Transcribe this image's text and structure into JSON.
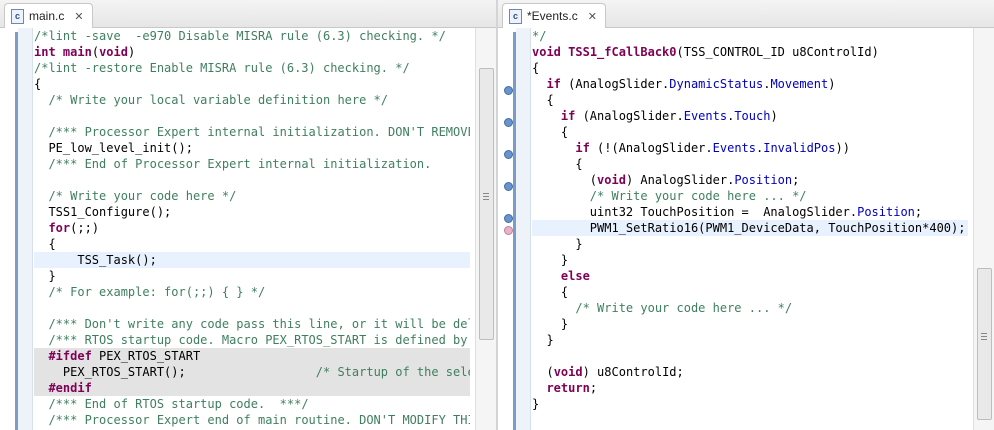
{
  "left": {
    "tab": {
      "label": "main.c",
      "icon": "c-file-icon"
    },
    "lines": [
      [
        {
          "t": "/*lint -save  -e970 Disable MISRA rule (6.3) checking. */",
          "c": "c"
        }
      ],
      [
        {
          "t": "int",
          "c": "k"
        },
        {
          "t": " "
        },
        {
          "t": "main",
          "c": "k"
        },
        {
          "t": "("
        },
        {
          "t": "void",
          "c": "k"
        },
        {
          "t": ")"
        }
      ],
      [
        {
          "t": "/*lint -restore Enable MISRA rule (6.3) checking. */",
          "c": "c"
        }
      ],
      [
        {
          "t": "{"
        }
      ],
      [
        {
          "t": "  "
        },
        {
          "t": "/* Write your local variable definition here */",
          "c": "c"
        }
      ],
      [],
      [
        {
          "t": "  "
        },
        {
          "t": "/*** Processor Expert internal initialization. DON'T REMOVE THIS CODE!!! ***/",
          "c": "c"
        }
      ],
      [
        {
          "t": "  PE_low_level_init();"
        }
      ],
      [
        {
          "t": "  "
        },
        {
          "t": "/*** End of Processor Expert internal initialization.                    ***/",
          "c": "c"
        }
      ],
      [],
      [
        {
          "t": "  "
        },
        {
          "t": "/* Write your code here */",
          "c": "c"
        }
      ],
      [
        {
          "t": "  TSS1_Configure();"
        }
      ],
      [
        {
          "t": "  "
        },
        {
          "t": "for",
          "c": "k"
        },
        {
          "t": "(;;)"
        }
      ],
      [
        {
          "t": "  {"
        }
      ],
      [
        {
          "t": "      TSS_Task();"
        }
      ],
      [
        {
          "t": "  }"
        }
      ],
      [
        {
          "t": "  "
        },
        {
          "t": "/* For example: for(;;) { } */",
          "c": "c"
        }
      ],
      [],
      [
        {
          "t": "  "
        },
        {
          "t": "/*** Don't write any code pass this line, or it will be deleted during code generation. ***/",
          "c": "c"
        }
      ],
      [
        {
          "t": "  "
        },
        {
          "t": "/*** RTOS startup code. Macro PEX_RTOS_START is defined by the RTOS component. DON'T MODIFY THIS CODE!!! ***/",
          "c": "c"
        }
      ],
      [
        {
          "t": "  "
        },
        {
          "t": "#ifdef",
          "c": "k"
        },
        {
          "t": " PEX_RTOS_START"
        }
      ],
      [
        {
          "t": "    PEX_RTOS_START();                  "
        },
        {
          "t": "/* Startup of the selected RTOS. Macro is defined by the RTOS component. */",
          "c": "c"
        }
      ],
      [
        {
          "t": "  "
        },
        {
          "t": "#endif",
          "c": "k"
        }
      ],
      [
        {
          "t": "  "
        },
        {
          "t": "/*** End of RTOS startup code.  ***/",
          "c": "c"
        }
      ],
      [
        {
          "t": "  "
        },
        {
          "t": "/*** Processor Expert end of main routine. DON'T MODIFY THIS CODE!!! ***/",
          "c": "c"
        }
      ]
    ]
  },
  "right": {
    "tab": {
      "label": "*Events.c",
      "icon": "c-file-icon"
    },
    "lines": [
      [
        {
          "t": "*/",
          "c": "c"
        }
      ],
      [
        {
          "t": "void",
          "c": "k"
        },
        {
          "t": " "
        },
        {
          "t": "TSS1_fCallBack0",
          "c": "k"
        },
        {
          "t": "(TSS_CONTROL_ID u8ControlId)"
        }
      ],
      [
        {
          "t": "{"
        }
      ],
      [
        {
          "t": "  "
        },
        {
          "t": "if",
          "c": "k"
        },
        {
          "t": " (AnalogSlider."
        },
        {
          "t": "DynamicStatus",
          "c": "f"
        },
        {
          "t": "."
        },
        {
          "t": "Movement",
          "c": "f"
        },
        {
          "t": ")"
        }
      ],
      [
        {
          "t": "  {"
        }
      ],
      [
        {
          "t": "    "
        },
        {
          "t": "if",
          "c": "k"
        },
        {
          "t": " (AnalogSlider."
        },
        {
          "t": "Events",
          "c": "f"
        },
        {
          "t": "."
        },
        {
          "t": "Touch",
          "c": "f"
        },
        {
          "t": ")"
        }
      ],
      [
        {
          "t": "    {"
        }
      ],
      [
        {
          "t": "      "
        },
        {
          "t": "if",
          "c": "k"
        },
        {
          "t": " (!(AnalogSlider."
        },
        {
          "t": "Events",
          "c": "f"
        },
        {
          "t": "."
        },
        {
          "t": "InvalidPos",
          "c": "f"
        },
        {
          "t": "))"
        }
      ],
      [
        {
          "t": "      {"
        }
      ],
      [
        {
          "t": "        ("
        },
        {
          "t": "void",
          "c": "k"
        },
        {
          "t": ") AnalogSlider."
        },
        {
          "t": "Position",
          "c": "f"
        },
        {
          "t": ";"
        }
      ],
      [
        {
          "t": "        "
        },
        {
          "t": "/* Write your code here ... */",
          "c": "c"
        }
      ],
      [
        {
          "t": "        uint32 TouchPosition =  AnalogSlider."
        },
        {
          "t": "Position",
          "c": "f"
        },
        {
          "t": ";"
        }
      ],
      [
        {
          "t": "        PWM1_SetRatio16(PWM1_DeviceData, TouchPosition*400);"
        }
      ],
      [
        {
          "t": "      }"
        }
      ],
      [
        {
          "t": "    }"
        }
      ],
      [
        {
          "t": "    "
        },
        {
          "t": "else",
          "c": "k"
        }
      ],
      [
        {
          "t": "    {"
        }
      ],
      [
        {
          "t": "      "
        },
        {
          "t": "/* Write your code here ... */",
          "c": "c"
        }
      ],
      [
        {
          "t": "    }"
        }
      ],
      [
        {
          "t": "  }"
        }
      ],
      [],
      [
        {
          "t": "  ("
        },
        {
          "t": "void",
          "c": "k"
        },
        {
          "t": ") u8ControlId;"
        }
      ],
      [
        {
          "t": "  "
        },
        {
          "t": "return",
          "c": "k"
        },
        {
          "t": ";"
        }
      ],
      [
        {
          "t": "}"
        }
      ]
    ]
  }
}
